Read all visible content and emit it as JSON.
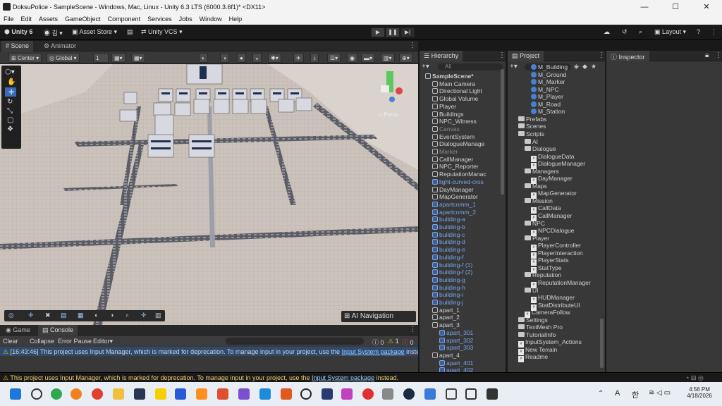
{
  "window": {
    "title": "DoksuPolice - SampleScene - Windows, Mac, Linux - Unity 6.3 LTS (6000.3.6f1)* <DX11>",
    "min": "—",
    "max": "☐",
    "close": "✕"
  },
  "menu": [
    "File",
    "Edit",
    "Assets",
    "GameObject",
    "Component",
    "Services",
    "Jobs",
    "Window",
    "Help"
  ],
  "toolbar": {
    "unity": "Unity 6",
    "account": "김",
    "asset_store": "Asset Store",
    "vcs": "Unity VCS",
    "layout": "Layout"
  },
  "scene_tabs": {
    "scene": "Scene",
    "animator": "Animator"
  },
  "scene_toolbar": {
    "pivot": "Center",
    "space": "Global",
    "snap": "1"
  },
  "viewport": {
    "gizmo_label": "◁ Persp",
    "ai_nav": "AI Navigation"
  },
  "hierarchy": {
    "tab": "Hierarchy",
    "search_placeholder": "All",
    "items": [
      {
        "t": "SampleScene*",
        "d": 0,
        "k": "scene"
      },
      {
        "t": "Main Camera",
        "d": 1,
        "k": "go"
      },
      {
        "t": "Directional Light",
        "d": 1,
        "k": "go"
      },
      {
        "t": "Global Volume",
        "d": 1,
        "k": "go"
      },
      {
        "t": "Player",
        "d": 1,
        "k": "go"
      },
      {
        "t": "Buildings",
        "d": 1,
        "k": "go"
      },
      {
        "t": "NPC_Witness",
        "d": 1,
        "k": "go"
      },
      {
        "t": "Canvas",
        "d": 1,
        "k": "dis"
      },
      {
        "t": "EventSystem",
        "d": 1,
        "k": "go"
      },
      {
        "t": "DialogueManage",
        "d": 1,
        "k": "go"
      },
      {
        "t": "Marker",
        "d": 1,
        "k": "dis"
      },
      {
        "t": "CallManager",
        "d": 1,
        "k": "go"
      },
      {
        "t": "NPC_Reporter",
        "d": 1,
        "k": "go"
      },
      {
        "t": "ReputationManac",
        "d": 1,
        "k": "go"
      },
      {
        "t": "light-curved-cros",
        "d": 1,
        "k": "pref"
      },
      {
        "t": "DayManager",
        "d": 1,
        "k": "go"
      },
      {
        "t": "MapGenerator",
        "d": 1,
        "k": "go"
      },
      {
        "t": "apartcomm_1",
        "d": 1,
        "k": "pref"
      },
      {
        "t": "apartcomm_2",
        "d": 1,
        "k": "pref"
      },
      {
        "t": "building-a",
        "d": 1,
        "k": "pref"
      },
      {
        "t": "building-b",
        "d": 1,
        "k": "pref"
      },
      {
        "t": "building-c",
        "d": 1,
        "k": "pref"
      },
      {
        "t": "building-d",
        "d": 1,
        "k": "pref"
      },
      {
        "t": "building-e",
        "d": 1,
        "k": "pref"
      },
      {
        "t": "building-f",
        "d": 1,
        "k": "pref"
      },
      {
        "t": "building-f (1)",
        "d": 1,
        "k": "pref"
      },
      {
        "t": "building-f (2)",
        "d": 1,
        "k": "pref"
      },
      {
        "t": "building-g",
        "d": 1,
        "k": "pref"
      },
      {
        "t": "building-h",
        "d": 1,
        "k": "pref"
      },
      {
        "t": "building-i",
        "d": 1,
        "k": "pref"
      },
      {
        "t": "building-j",
        "d": 1,
        "k": "pref"
      },
      {
        "t": "apart_1",
        "d": 1,
        "k": "go"
      },
      {
        "t": "apart_2",
        "d": 1,
        "k": "go"
      },
      {
        "t": "apart_3",
        "d": 1,
        "k": "go"
      },
      {
        "t": "apart_301",
        "d": 2,
        "k": "pref"
      },
      {
        "t": "apart_302",
        "d": 2,
        "k": "pref"
      },
      {
        "t": "apart_303",
        "d": 2,
        "k": "pref"
      },
      {
        "t": "apart_4",
        "d": 1,
        "k": "go"
      },
      {
        "t": "apart_401",
        "d": 2,
        "k": "pref"
      },
      {
        "t": "apart_402",
        "d": 2,
        "k": "pref"
      },
      {
        "t": "apart_403",
        "d": 2,
        "k": "pref"
      }
    ]
  },
  "project": {
    "tab": "Project",
    "items": [
      {
        "t": "M_Building",
        "d": 3,
        "k": "mat"
      },
      {
        "t": "M_Ground",
        "d": 3,
        "k": "mat"
      },
      {
        "t": "M_Marker",
        "d": 3,
        "k": "mat"
      },
      {
        "t": "M_NPC",
        "d": 3,
        "k": "mat"
      },
      {
        "t": "M_Player",
        "d": 3,
        "k": "mat"
      },
      {
        "t": "M_Road",
        "d": 3,
        "k": "mat"
      },
      {
        "t": "M_Station",
        "d": 3,
        "k": "mat"
      },
      {
        "t": "Prefabs",
        "d": 1,
        "k": "fold"
      },
      {
        "t": "Scenes",
        "d": 1,
        "k": "fold"
      },
      {
        "t": "Scripts",
        "d": 1,
        "k": "fold"
      },
      {
        "t": "AI",
        "d": 2,
        "k": "fold"
      },
      {
        "t": "Dialogue",
        "d": 2,
        "k": "fold"
      },
      {
        "t": "DialogueData",
        "d": 3,
        "k": "cs"
      },
      {
        "t": "DialogueManager",
        "d": 3,
        "k": "cs"
      },
      {
        "t": "Managers",
        "d": 2,
        "k": "fold"
      },
      {
        "t": "DayManager",
        "d": 3,
        "k": "cs"
      },
      {
        "t": "Maps",
        "d": 2,
        "k": "fold"
      },
      {
        "t": "MapGenerator",
        "d": 3,
        "k": "cs"
      },
      {
        "t": "Mission",
        "d": 2,
        "k": "fold"
      },
      {
        "t": "CallData",
        "d": 3,
        "k": "cs"
      },
      {
        "t": "CallManager",
        "d": 3,
        "k": "cs"
      },
      {
        "t": "NPC",
        "d": 2,
        "k": "fold"
      },
      {
        "t": "NPCDialogue",
        "d": 3,
        "k": "cs"
      },
      {
        "t": "Player",
        "d": 2,
        "k": "fold"
      },
      {
        "t": "PlayerController",
        "d": 3,
        "k": "cs"
      },
      {
        "t": "PlayerInteraction",
        "d": 3,
        "k": "cs"
      },
      {
        "t": "PlayerStats",
        "d": 3,
        "k": "cs"
      },
      {
        "t": "StatType",
        "d": 3,
        "k": "cs"
      },
      {
        "t": "Reputation",
        "d": 2,
        "k": "fold"
      },
      {
        "t": "ReputationManager",
        "d": 3,
        "k": "cs"
      },
      {
        "t": "UI",
        "d": 2,
        "k": "fold"
      },
      {
        "t": "HUDManager",
        "d": 3,
        "k": "cs"
      },
      {
        "t": "StatDistributeUI",
        "d": 3,
        "k": "cs"
      },
      {
        "t": "CameraFollow",
        "d": 2,
        "k": "cs"
      },
      {
        "t": "Settings",
        "d": 1,
        "k": "fold"
      },
      {
        "t": "TextMesh Pro",
        "d": 1,
        "k": "fold"
      },
      {
        "t": "TutorialInfo",
        "d": 1,
        "k": "fold"
      },
      {
        "t": "InputSystem_Actions",
        "d": 1,
        "k": "cs"
      },
      {
        "t": "New Terrain",
        "d": 1,
        "k": "cs"
      },
      {
        "t": "Readme",
        "d": 1,
        "k": "cs"
      }
    ]
  },
  "inspector": {
    "tab": "Inspector"
  },
  "bottom_tabs": {
    "game": "Game",
    "console": "Console"
  },
  "console": {
    "clear": "Clear",
    "collapse": "Collapse",
    "error_pause": "Error Pause",
    "editor": "Editor",
    "count_error": "0",
    "count_warn": "1",
    "count_info": "0",
    "log_time": "[16:43:46]",
    "log_pre": "This project uses Input Manager, which is marked for deprecation. To manage input in your project, use the ",
    "log_link": "Input System package",
    "log_post": " instead."
  },
  "status": {
    "pre": "This project uses Input Manager, which is marked for deprecation. To manage input in your project, use the ",
    "link": "Input System package",
    "post": " instead."
  },
  "taskbar": {
    "time": "4:56 PM",
    "date": "4/18/2026",
    "ime": "A",
    "hangul": "한"
  }
}
